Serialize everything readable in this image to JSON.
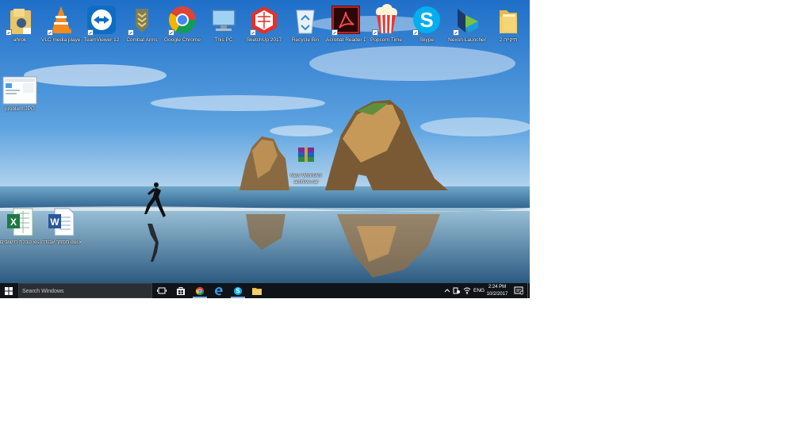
{
  "desktop_icons": [
    {
      "name": "desktop-icon-user-folder",
      "icon": "user-folder-icon",
      "label": "ahrok"
    },
    {
      "name": "desktop-icon-vlc",
      "icon": "vlc-icon",
      "label": "VLC media player"
    },
    {
      "name": "desktop-icon-teamviewer",
      "icon": "teamviewer-icon",
      "label": "TeamViewer 12"
    },
    {
      "name": "desktop-icon-combat-arms",
      "icon": "combat-arms-icon",
      "label": "Combat Arms"
    },
    {
      "name": "desktop-icon-google-chrome",
      "icon": "chrome-icon",
      "label": "Google Chrome"
    },
    {
      "name": "desktop-icon-this-pc",
      "icon": "computer-icon",
      "label": "This PC"
    },
    {
      "name": "desktop-icon-sketchup",
      "icon": "sketchup-icon",
      "label": "SketchUp 2017"
    },
    {
      "name": "desktop-icon-recycle-bin",
      "icon": "recycle-bin-icon",
      "label": "Recycle Bin"
    },
    {
      "name": "desktop-icon-acrobat-reader",
      "icon": "acrobat-icon",
      "label": "Acrobat Reader DC"
    },
    {
      "name": "desktop-icon-popcorn-time",
      "icon": "popcorn-icon",
      "label": "Popcorn Time"
    },
    {
      "name": "desktop-icon-skype",
      "icon": "skype-icon",
      "label": "Skype"
    },
    {
      "name": "desktop-icon-nexon-launcher",
      "icon": "nexon-icon",
      "label": "Nexon Launcher"
    },
    {
      "name": "desktop-icon-hebrew-folder",
      "icon": "folder-icon",
      "label": "תיקייה 2"
    },
    {
      "name": "desktop-icon-problem-screenshot",
      "icon": "screenshot-thumbnail-icon",
      "label": "problem.JPG"
    },
    {
      "name": "desktop-icon-winrar-archive",
      "icon": "winrar-icon",
      "label": "New WinRAR archive.rar"
    },
    {
      "name": "desktop-icon-excel-file",
      "icon": "excel-icon",
      "label": "טבלת חישובים.xlsx"
    },
    {
      "name": "desktop-icon-word-file",
      "icon": "word-icon",
      "label": "מסמך עבודה.docx"
    }
  ],
  "taskbar": {
    "search_placeholder": "Search Windows",
    "pinned": [
      {
        "name": "taskbar-task-view",
        "icon": "task-view-icon"
      },
      {
        "name": "taskbar-store",
        "icon": "store-icon"
      },
      {
        "name": "taskbar-chrome",
        "icon": "chrome-icon"
      },
      {
        "name": "taskbar-edge",
        "icon": "edge-icon"
      },
      {
        "name": "taskbar-skype",
        "icon": "skype-icon"
      },
      {
        "name": "taskbar-file-explorer",
        "icon": "file-explorer-icon"
      }
    ],
    "tray": {
      "language": "ENG",
      "time": "2:24 PM",
      "date": "10/2/2017"
    }
  },
  "colors": {
    "taskbar": "#101418",
    "sky": "#2e7fd1",
    "accent": "#7aaee0"
  }
}
